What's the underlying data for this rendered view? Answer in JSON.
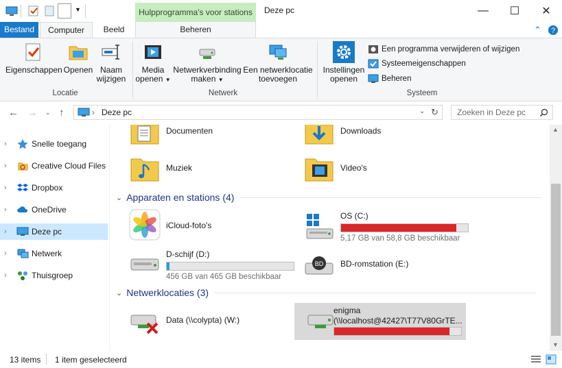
{
  "window": {
    "title": "Deze pc",
    "context_tab_group": "Hulpprogramma's voor stations",
    "controls": {
      "minimize": "—",
      "maximize": "☐",
      "close": "✕"
    }
  },
  "ribbon_tabs": {
    "file": "Bestand",
    "computer": "Computer",
    "view": "Beeld",
    "manage": "Beheren"
  },
  "ribbon": {
    "groups": {
      "location": "Locatie",
      "network": "Netwerk",
      "system": "Systeem"
    },
    "buttons": {
      "properties": "Eigenschappen",
      "open": "Openen",
      "rename_1": "Naam",
      "rename_2": "wijzigen",
      "media_1": "Media",
      "media_2": "openen",
      "map_drive_1": "Netwerkverbinding",
      "map_drive_2": "maken",
      "add_location_1": "Een netwerklocatie",
      "add_location_2": "toevoegen",
      "settings_1": "Instellingen",
      "settings_2": "openen"
    },
    "system_items": {
      "uninstall": "Een programma verwijderen of wijzigen",
      "system_properties": "Systeemeigenschappen",
      "manage": "Beheren"
    }
  },
  "address": {
    "path": "Deze pc",
    "search_placeholder": "Zoeken in Deze pc"
  },
  "sidebar": {
    "items": [
      {
        "label": "Snelle toegang"
      },
      {
        "label": "Creative Cloud Files"
      },
      {
        "label": "Dropbox"
      },
      {
        "label": "OneDrive"
      },
      {
        "label": "Deze pc"
      },
      {
        "label": "Netwerk"
      },
      {
        "label": "Thuisgroep"
      }
    ]
  },
  "folders": [
    {
      "name": "Documenten"
    },
    {
      "name": "Downloads"
    },
    {
      "name": "Muziek"
    },
    {
      "name": "Video's"
    }
  ],
  "devices": {
    "header": "Apparaten en stations (4)",
    "items": [
      {
        "name": "iCloud-foto's"
      },
      {
        "name": "OS (C:)",
        "sub": "5,17 GB van 58,8 GB beschikbaar",
        "used_fraction": 0.91
      },
      {
        "name": "D-schijf (D:)",
        "sub": "456 GB van 465 GB beschikbaar",
        "used_fraction": 0.02
      },
      {
        "name": "BD-romstation (E:)"
      }
    ]
  },
  "network_locations": {
    "header": "Netwerklocaties (3)",
    "items": [
      {
        "name": "Data (\\\\colypta) (W:)"
      },
      {
        "name": "enigma",
        "path": "(\\\\localhost@42427\\T77V80GrTE...",
        "used_fraction": 0.91
      }
    ]
  },
  "status": {
    "items": "13 items",
    "selected": "1 item geselecteerd"
  },
  "colors": {
    "accent": "#1979ca",
    "context_tab": "#c7ecbf",
    "drive_full": "#da2626",
    "drive_ok": "#26a0da",
    "selection": "#cce8ff"
  }
}
